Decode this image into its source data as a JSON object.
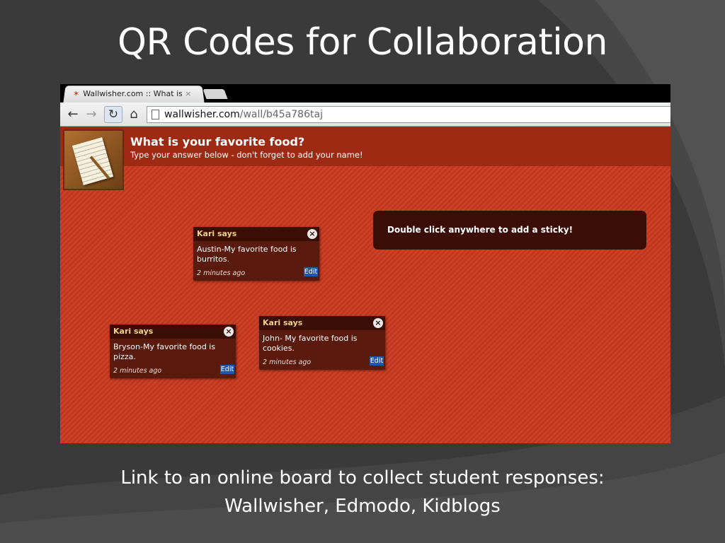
{
  "slide": {
    "title": "QR Codes for Collaboration",
    "caption_line1": "Link to an online board to collect student responses:",
    "caption_line2": "Wallwisher, Edmodo, Kidblogs"
  },
  "browser": {
    "tab_title": "Wallwisher.com :: What is y",
    "tab_close": "×",
    "url_host": "wallwisher.com",
    "url_path": "/wall/b45a786taj"
  },
  "wall": {
    "title": "What is your favorite food?",
    "subtitle": "Type your answer below - don't forget to add your name!",
    "hint": "Double click anywhere to add a sticky!"
  },
  "stickies": [
    {
      "author": "Kari says",
      "text": "Austin-My favorite food is burritos.",
      "time": "2 minutes ago",
      "edit": "Edit"
    },
    {
      "author": "Kari says",
      "text": "Bryson-My favorite food is pizza.",
      "time": "2 minutes ago",
      "edit": "Edit"
    },
    {
      "author": "Kari says",
      "text": "John- My favorite food is cookies.",
      "time": "2 minutes ago",
      "edit": "Edit"
    }
  ],
  "colors": {
    "slide_bg": "#3a3a3a",
    "wall_bg": "#c8391f",
    "sticky_bg": "#5a1a0d",
    "sticky_author": "#f0d28a",
    "edit_bg": "#1f56b0"
  }
}
